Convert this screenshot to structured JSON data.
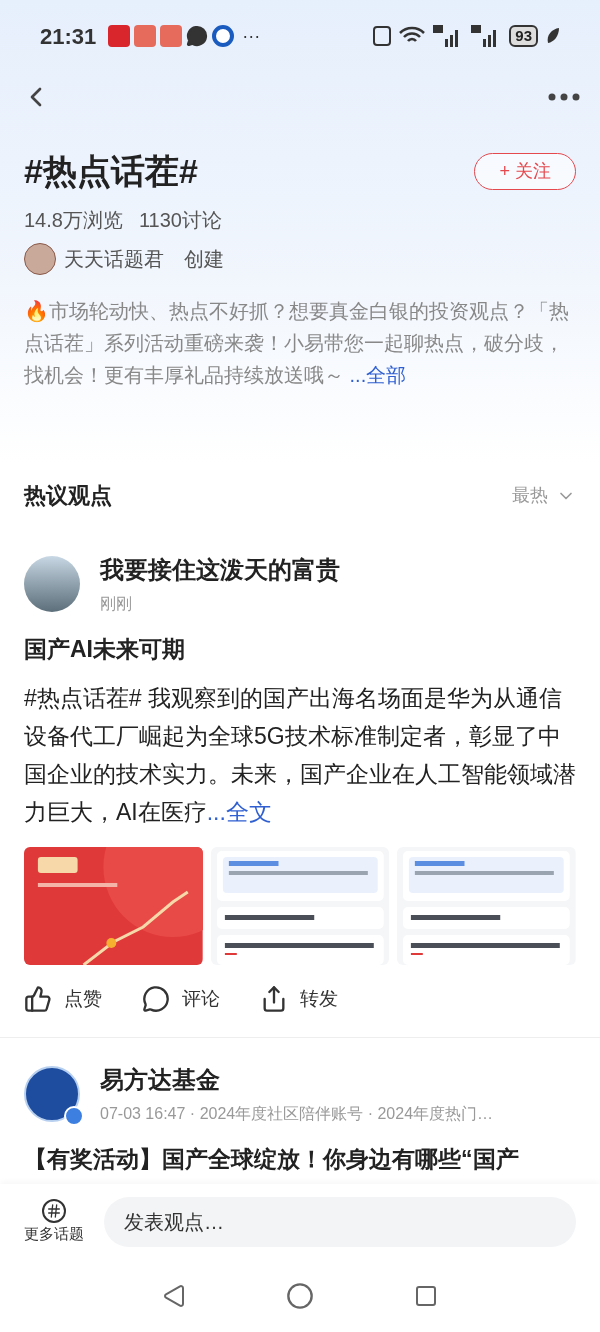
{
  "status_bar": {
    "time": "21:31",
    "more": "···",
    "battery": "93"
  },
  "topic": {
    "title": "#热点话茬#",
    "follow_button": "+ 关注",
    "followed": false,
    "views": "14.8万浏览",
    "discussions": "1130讨论",
    "creator": "天天话题君",
    "creator_action": "创建",
    "description": "🔥市场轮动快、热点不好抓？想要真金白银的投资观点？「热点话茬」系列活动重磅来袭！小易带您一起聊热点，破分歧，找机会！更有丰厚礼品持续放送哦～",
    "more_link": "...全部"
  },
  "section": {
    "title": "热议观点",
    "sort": "最热"
  },
  "posts": [
    {
      "author": "我要接住这泼天的富贵",
      "time": "刚刚",
      "verified": false,
      "title": "国产AI未来可期",
      "body": " #热点话茬# 我观察到的国产出海名场面是华为从通信设备代工厂崛起为全球5G技术标准制定者，彰显了中国企业的技术实力。未来，国产企业在人工智能领域潜力巨大，AI在医疗",
      "full_link": "...全文",
      "actions": [
        "点赞",
        "评论",
        "转发"
      ]
    },
    {
      "author": "易方达基金",
      "time": "07-03 16:47 · 2024年度社区陪伴账号 · 2024年度热门…",
      "verified": true,
      "title": "【有奖活动】国产全球绽放！你身边有哪些“国产"
    }
  ],
  "bottom_bar": {
    "more_topics": "更多话题",
    "compose_placeholder": "发表观点…"
  }
}
